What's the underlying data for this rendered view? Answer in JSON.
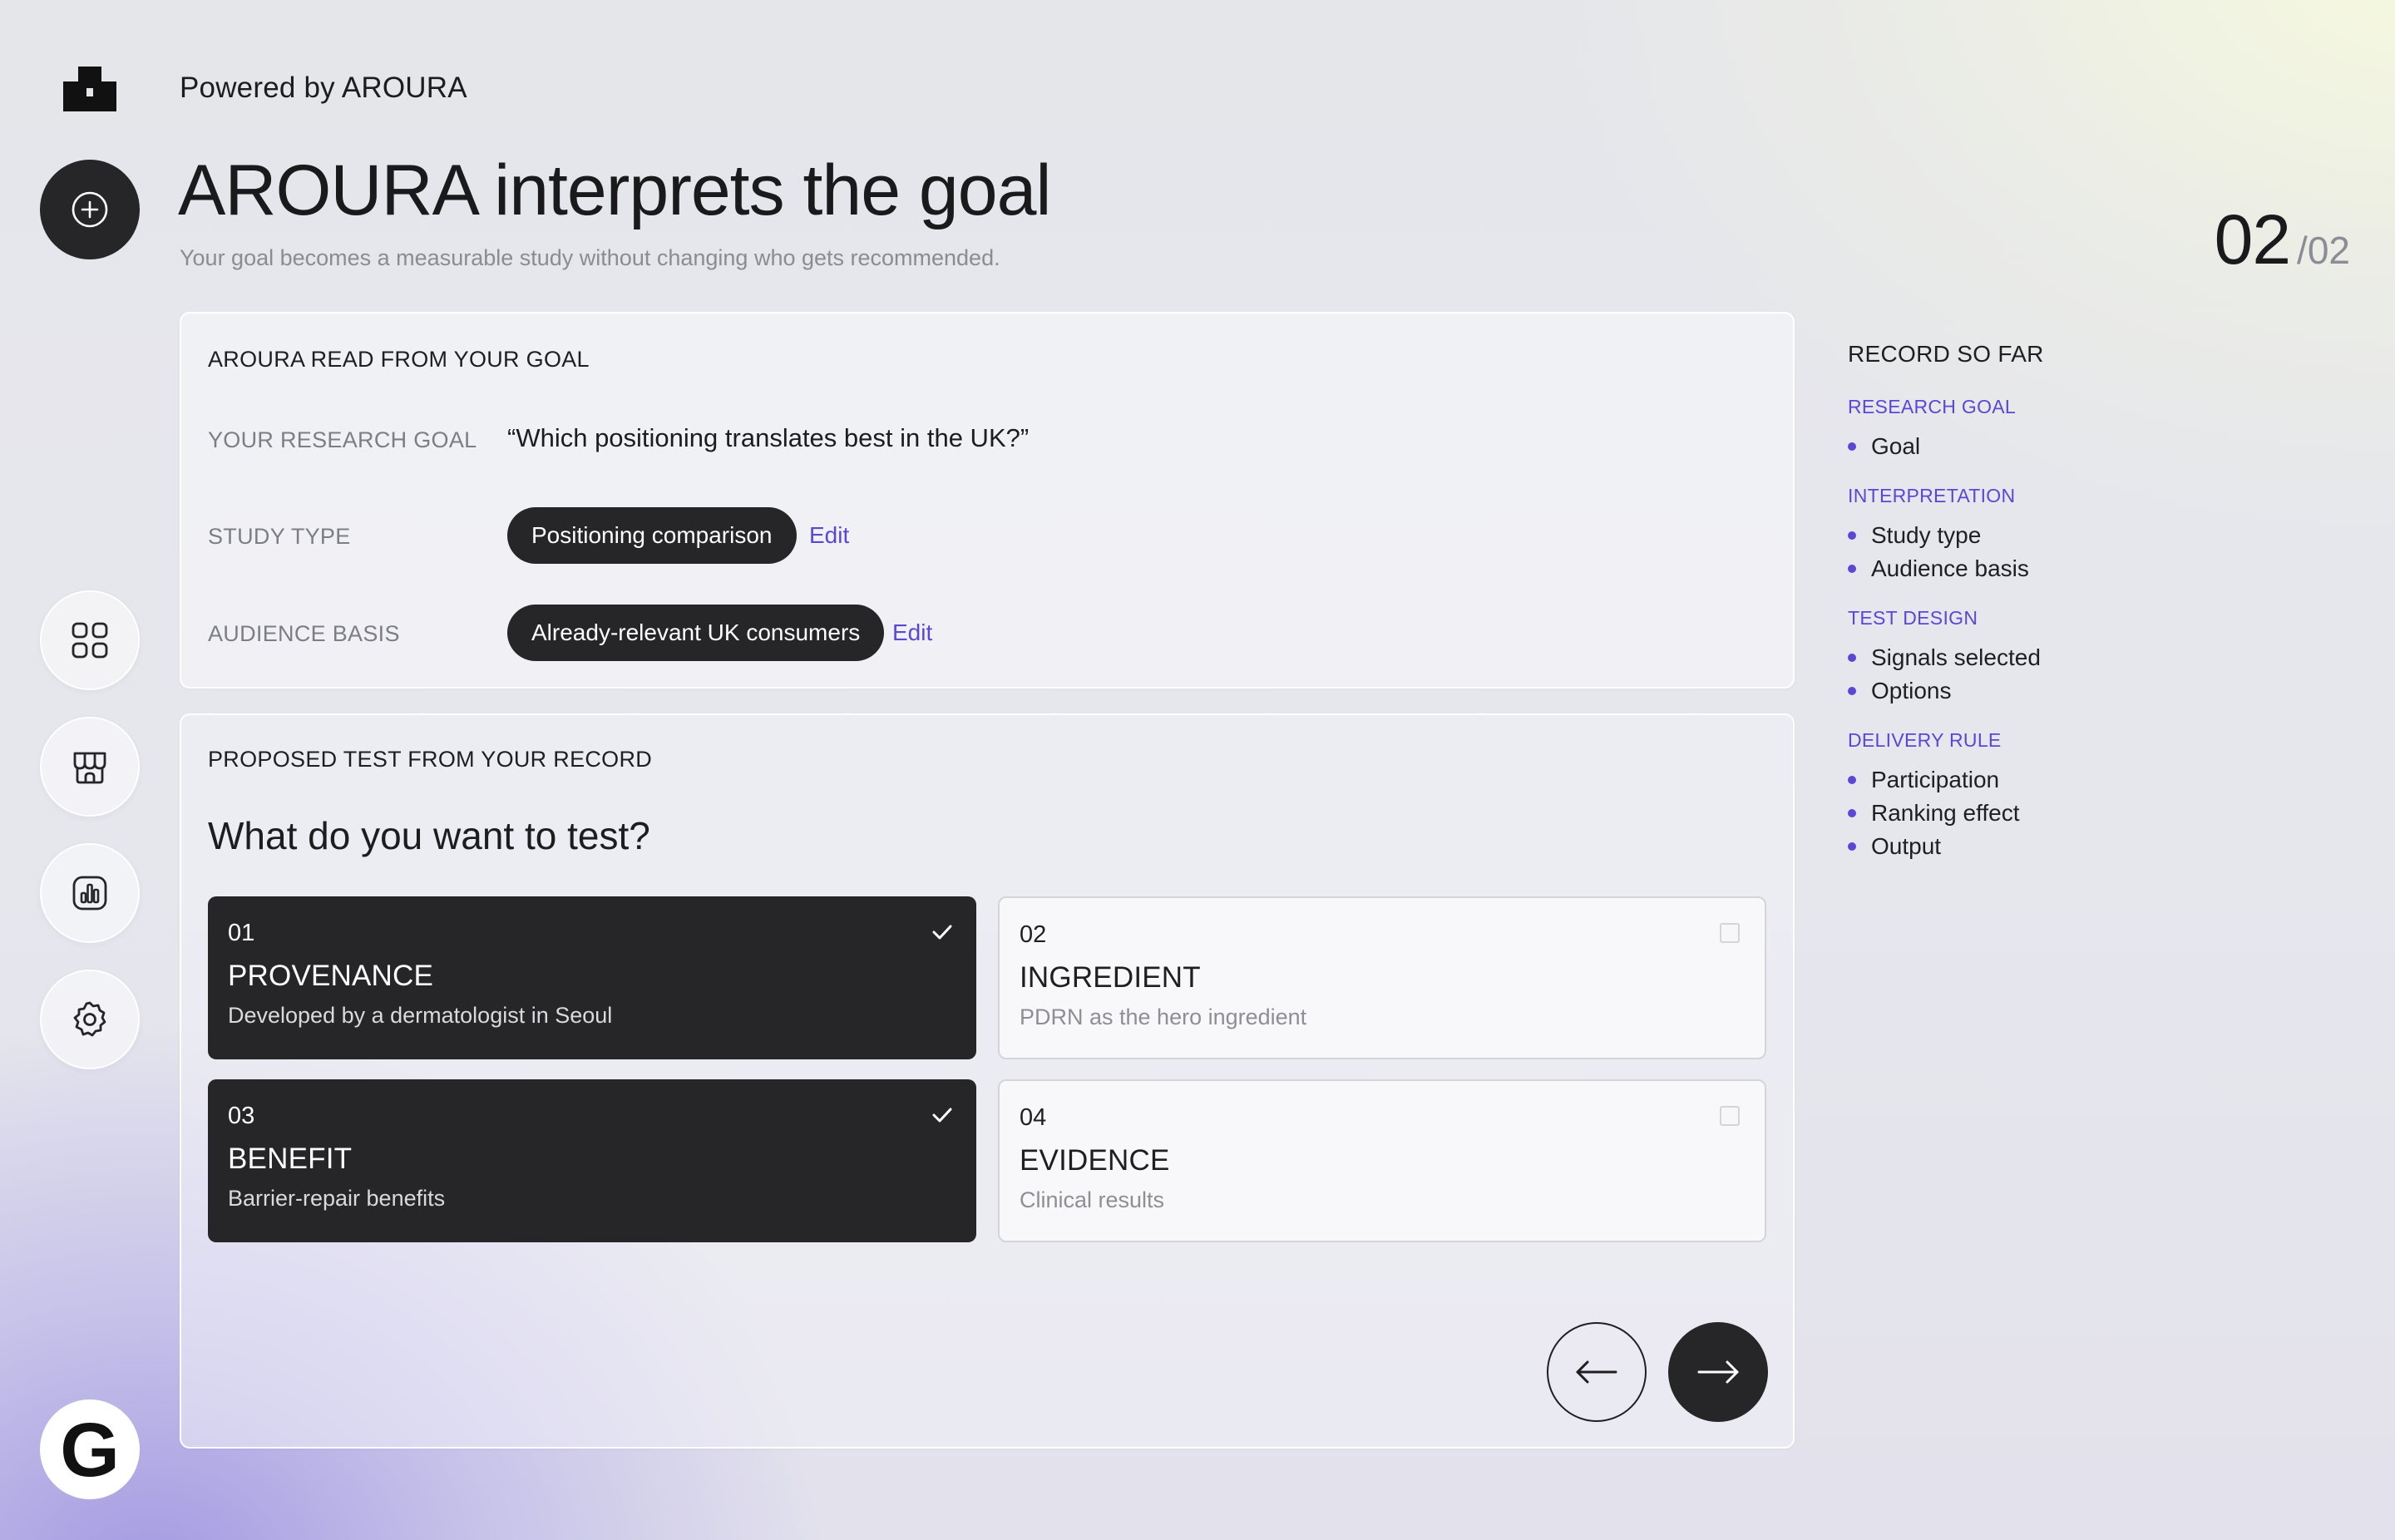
{
  "brand": {
    "powered_by": "Powered by AROURA"
  },
  "header": {
    "title": "AROURA interprets the goal",
    "subtitle": "Your goal becomes a measurable study without changing who gets recommended.",
    "step_current": "02",
    "step_total": "/02"
  },
  "sidebar": {
    "icons": [
      "plus-circle-icon",
      "grid-icon",
      "store-icon",
      "chart-icon",
      "settings-icon"
    ],
    "bottom_badge": "G"
  },
  "interpretation": {
    "heading": "AROURA READ FROM YOUR GOAL",
    "goal_label": "YOUR RESEARCH GOAL",
    "goal_value": "“Which positioning translates best in the UK?”",
    "study_type_label": "STUDY TYPE",
    "study_type_value": "Positioning comparison",
    "study_type_edit": "Edit",
    "audience_label": "AUDIENCE BASIS",
    "audience_value": "Already-relevant UK consumers",
    "audience_edit": "Edit"
  },
  "test": {
    "heading": "PROPOSED TEST FROM YOUR RECORD",
    "question": "What do you want to test?",
    "options": [
      {
        "num": "01",
        "title": "PROVENANCE",
        "desc": "Developed by a dermatologist in Seoul",
        "selected": true
      },
      {
        "num": "02",
        "title": "INGREDIENT",
        "desc": "PDRN as the hero ingredient",
        "selected": false
      },
      {
        "num": "03",
        "title": "BENEFIT",
        "desc": "Barrier-repair benefits",
        "selected": true
      },
      {
        "num": "04",
        "title": "EVIDENCE",
        "desc": "Clinical results",
        "selected": false
      }
    ]
  },
  "record": {
    "title": "RECORD SO FAR",
    "sections": [
      {
        "heading": "RESEARCH GOAL",
        "items": [
          "Goal"
        ]
      },
      {
        "heading": "INTERPRETATION",
        "items": [
          "Study type",
          "Audience basis"
        ]
      },
      {
        "heading": "TEST DESIGN",
        "items": [
          "Signals selected",
          "Options"
        ]
      },
      {
        "heading": "DELIVERY RULE",
        "items": [
          "Participation",
          "Ranking effect",
          "Output"
        ]
      }
    ]
  },
  "colors": {
    "accent": "#5a47d6",
    "dark": "#262628"
  }
}
